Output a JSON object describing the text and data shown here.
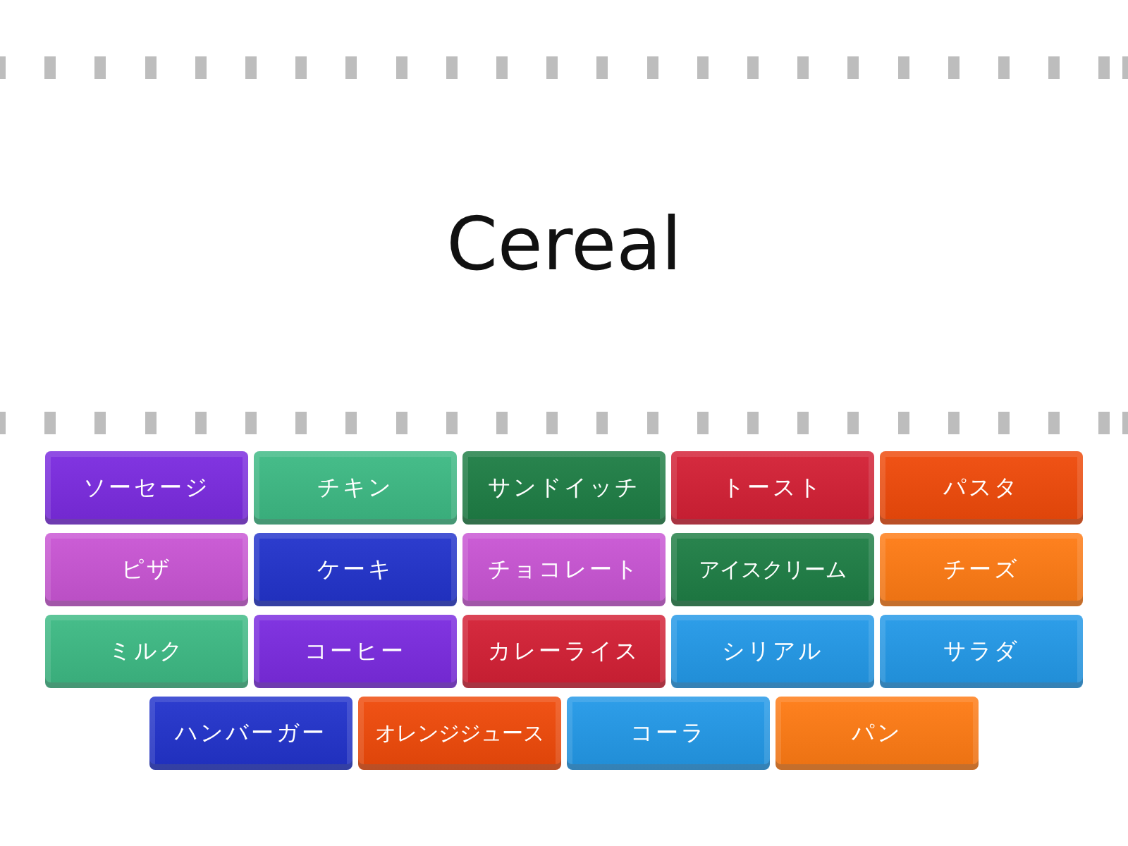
{
  "prompt": "Cereal",
  "tiles": [
    {
      "label": "ソーセージ",
      "color": "#7b2be0"
    },
    {
      "label": "チキン",
      "color": "#3dba84"
    },
    {
      "label": "サンドイッチ",
      "color": "#1e7e45"
    },
    {
      "label": "トースト",
      "color": "#d42035"
    },
    {
      "label": "パスタ",
      "color": "#f04a0a"
    },
    {
      "label": "ピザ",
      "color": "#c955d4"
    },
    {
      "label": "ケーキ",
      "color": "#2233cc"
    },
    {
      "label": "チョコレート",
      "color": "#c955d4"
    },
    {
      "label": "アイスクリーム",
      "color": "#1e7e45"
    },
    {
      "label": "チーズ",
      "color": "#ff7b14"
    },
    {
      "label": "ミルク",
      "color": "#3dba84"
    },
    {
      "label": "コーヒー",
      "color": "#7b2be0"
    },
    {
      "label": "カレーライス",
      "color": "#d42035"
    },
    {
      "label": "シリアル",
      "color": "#2399e8"
    },
    {
      "label": "サラダ",
      "color": "#2399e8"
    },
    {
      "label": "ハンバーガー",
      "color": "#2233cc"
    },
    {
      "label": "オレンジジュース",
      "color": "#f04a0a"
    },
    {
      "label": "コーラ",
      "color": "#2399e8"
    },
    {
      "label": "パン",
      "color": "#ff7b14"
    }
  ]
}
